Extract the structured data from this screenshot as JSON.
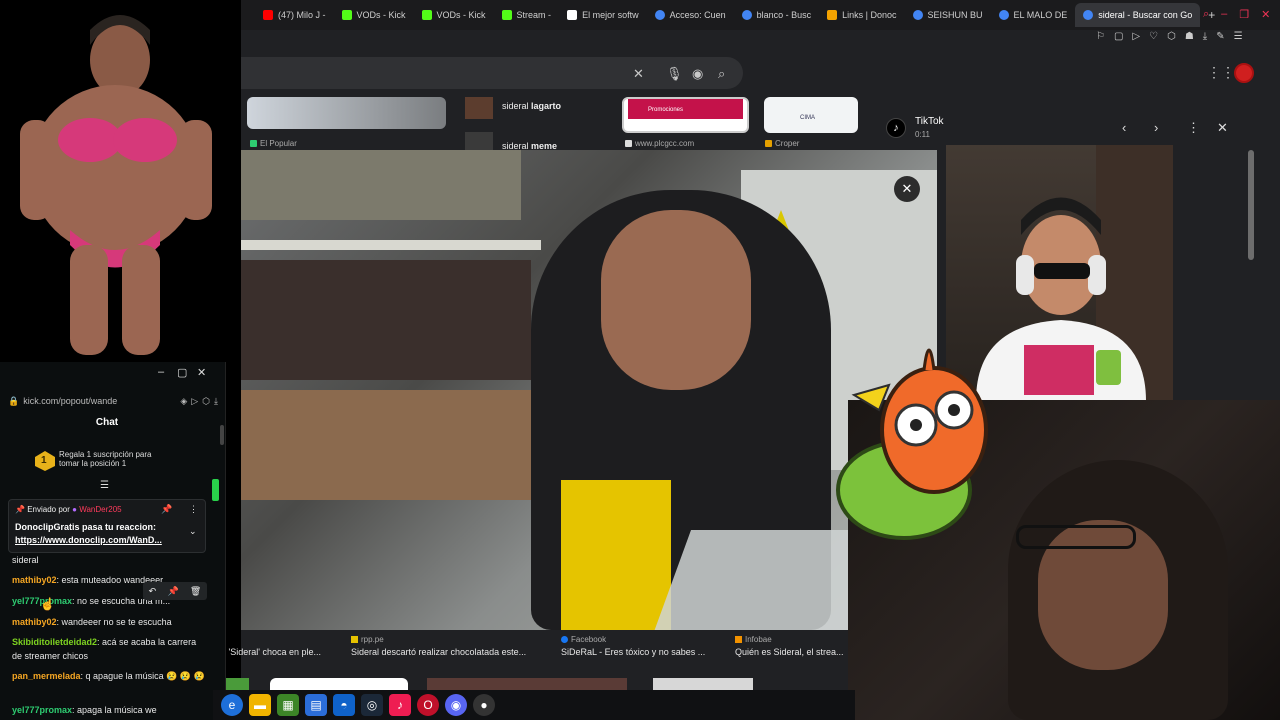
{
  "browser": {
    "tabs": [
      {
        "label": "(47) Milo J - ",
        "color": "#ff0000"
      },
      {
        "label": "VODs - Kick",
        "color": "#53fc18"
      },
      {
        "label": "VODs - Kick",
        "color": "#53fc18"
      },
      {
        "label": "Stream - ",
        "color": "#53fc18"
      },
      {
        "label": "El mejor softw",
        "color": "#ffffff"
      },
      {
        "label": "Acceso: Cuen",
        "color": "#4285f4"
      },
      {
        "label": "blanco - Busc",
        "color": "#4285f4"
      },
      {
        "label": "Links | Donoc",
        "color": "#f4a300"
      },
      {
        "label": "SEISHUN BU",
        "color": "#4285f4"
      },
      {
        "label": "EL MALO DE",
        "color": "#4285f4"
      },
      {
        "label": "sideral - Buscar con Go",
        "color": "#4285f4"
      }
    ],
    "profile_color": "#d01f1f"
  },
  "results": {
    "thumb1_source": "El Popular",
    "related1": {
      "prefix": "sideral ",
      "bold": "lagarto"
    },
    "related2": {
      "prefix": "sideral ",
      "bold": "meme"
    },
    "thumb3_source": "www.plcgcc.com",
    "thumb4_source": "Croper",
    "thumb4_label": "CIMA",
    "thumb3_label": "Promociones"
  },
  "captions": [
    {
      "source": "",
      "title": "ner 'Sideral' choca en ple..."
    },
    {
      "source": "rpp.pe",
      "title": "Sideral descartó realizar chocolatada este..."
    },
    {
      "source": "Facebook",
      "title": "SiDeRaL - Eres tóxico y no sabes ..."
    },
    {
      "source": "Infobae",
      "title": "Quién es Sideral, el strea..."
    }
  ],
  "tiktok": {
    "title": "TikTok",
    "time": "0:11"
  },
  "chat": {
    "url": "kick.com/popout/wande",
    "heading": "Chat",
    "gift_number": "1",
    "gift_text_1": "Regala 1 suscripción para",
    "gift_text_2": "tomar la posición 1",
    "pinned_by_label": "Enviado por",
    "pinned_by_user": "WanDer205",
    "pinned_msg": "DonoclipGratis pasa tu reaccion:",
    "pinned_link": "https://www.donoclip.com/WanD...",
    "messages": [
      {
        "user": "",
        "color": "#e8e8e8",
        "text": "sideral"
      },
      {
        "user": "mathiby02",
        "color": "#f5a623",
        "text": ": esta muteadoo wandeeer"
      },
      {
        "user": "yel777promax",
        "color": "#2ecc71",
        "text": ": no se escucha una m..."
      },
      {
        "user": "mathiby02",
        "color": "#f5a623",
        "text": ": wandeeer no se te escucha"
      },
      {
        "user": "Skibiditoiletdeidad2",
        "color": "#7ed321",
        "text": ": acá se acaba la carrera de streamer chicos"
      },
      {
        "user": "pan_mermelada",
        "color": "#f5a623",
        "text": ": q apague la música 😢 😢 😢"
      },
      {
        "user": "yel777promax",
        "color": "#2ecc71",
        "text": ": apaga la música we"
      }
    ]
  }
}
